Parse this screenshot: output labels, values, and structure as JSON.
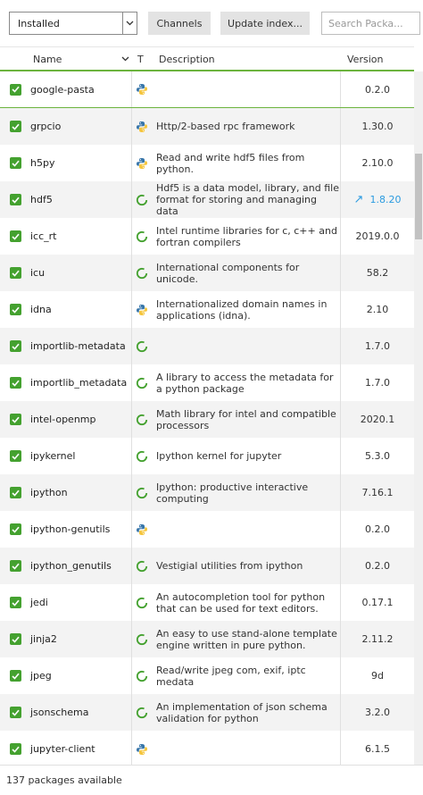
{
  "toolbar": {
    "filter_value": "Installed",
    "channels_label": "Channels",
    "update_index_label": "Update index...",
    "search_placeholder": "Search Packa..."
  },
  "columns": {
    "name": "Name",
    "type": "T",
    "description": "Description",
    "version": "Version"
  },
  "colors": {
    "accent": "#6cb33e",
    "check": "#44a12f",
    "update": "#2b9be0"
  },
  "packages": [
    {
      "name": "google-pasta",
      "type": "python",
      "description": "",
      "version": "0.2.0"
    },
    {
      "name": "grpcio",
      "type": "python",
      "description": "Http/2-based rpc framework",
      "version": "1.30.0"
    },
    {
      "name": "h5py",
      "type": "python",
      "description": "Read and write hdf5 files from python.",
      "version": "2.10.0"
    },
    {
      "name": "hdf5",
      "type": "conda",
      "description": "Hdf5 is a data model, library, and file format for storing and managing data",
      "version": "1.8.20",
      "update": true
    },
    {
      "name": "icc_rt",
      "type": "conda",
      "description": "Intel runtime libraries for c, c++ and fortran compilers",
      "version": "2019.0.0"
    },
    {
      "name": "icu",
      "type": "conda",
      "description": "International components for unicode.",
      "version": "58.2"
    },
    {
      "name": "idna",
      "type": "python",
      "description": "Internationalized domain names in applications (idna).",
      "version": "2.10"
    },
    {
      "name": "importlib-metadata",
      "type": "conda",
      "description": "",
      "version": "1.7.0"
    },
    {
      "name": "importlib_metadata",
      "type": "conda",
      "description": "A library to access the metadata for a python package",
      "version": "1.7.0"
    },
    {
      "name": "intel-openmp",
      "type": "conda",
      "description": "Math library for intel and compatible processors",
      "version": "2020.1"
    },
    {
      "name": "ipykernel",
      "type": "conda",
      "description": "Ipython kernel for jupyter",
      "version": "5.3.0"
    },
    {
      "name": "ipython",
      "type": "conda",
      "description": "Ipython: productive interactive computing",
      "version": "7.16.1"
    },
    {
      "name": "ipython-genutils",
      "type": "python",
      "description": "",
      "version": "0.2.0"
    },
    {
      "name": "ipython_genutils",
      "type": "conda",
      "description": "Vestigial utilities from ipython",
      "version": "0.2.0"
    },
    {
      "name": "jedi",
      "type": "conda",
      "description": "An autocompletion tool for python that can be used for text editors.",
      "version": "0.17.1"
    },
    {
      "name": "jinja2",
      "type": "conda",
      "description": "An easy to use stand-alone template engine written in pure python.",
      "version": "2.11.2"
    },
    {
      "name": "jpeg",
      "type": "conda",
      "description": "Read/write jpeg com, exif, iptc medata",
      "version": "9d"
    },
    {
      "name": "jsonschema",
      "type": "conda",
      "description": "An implementation of json schema validation for python",
      "version": "3.2.0"
    },
    {
      "name": "jupyter-client",
      "type": "python",
      "description": "",
      "version": "6.1.5"
    }
  ],
  "footer": {
    "status": "137 packages available"
  }
}
